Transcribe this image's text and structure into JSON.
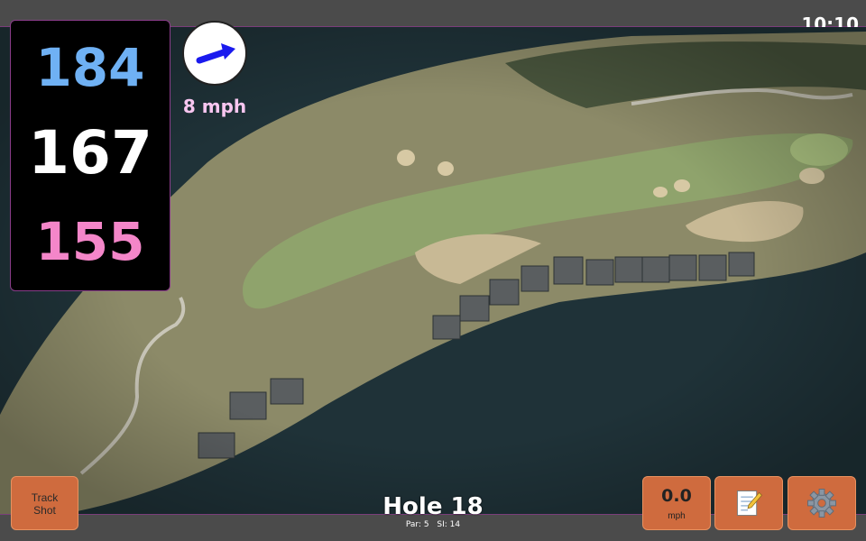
{
  "status_bar": {
    "time": "10:10"
  },
  "distances": {
    "back": "184",
    "middle": "167",
    "front": "155"
  },
  "wind": {
    "speed_label": "8 mph",
    "direction_icon": "wind-arrow-icon"
  },
  "hole": {
    "title": "Hole 18",
    "par_label": "Par: 5",
    "si_label": "SI: 14"
  },
  "buttons": {
    "track_shot": {
      "line1": "Track",
      "line2": "Shot"
    },
    "speed": {
      "value": "0.0",
      "unit": "mph"
    },
    "notes_icon": "notepad-icon",
    "settings_icon": "gear-icon"
  },
  "colors": {
    "back_distance": "#6fb1f4",
    "middle_distance": "#ffffff",
    "front_distance": "#f486c9",
    "button_bg": "#cf6b3e",
    "wind_arrow": "#1a1aee"
  }
}
